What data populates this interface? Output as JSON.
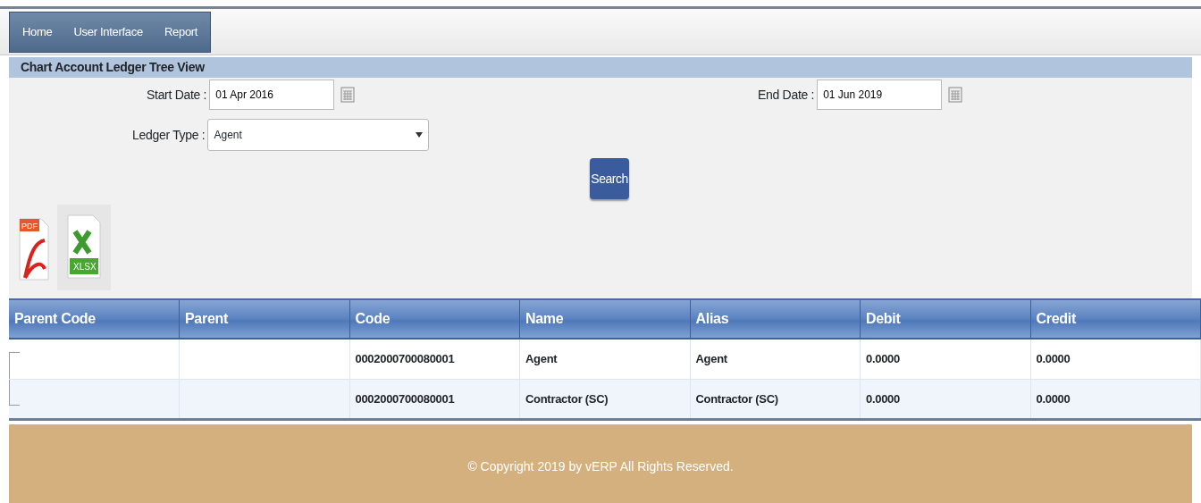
{
  "menu": [
    {
      "label": "Home"
    },
    {
      "label": "User Interface"
    },
    {
      "label": "Report"
    }
  ],
  "page_title": "Chart Account Ledger Tree View",
  "filters": {
    "start_date": {
      "label": "Start Date :",
      "value": "01 Apr 2016"
    },
    "end_date": {
      "label": "End Date :",
      "value": "01 Jun 2019"
    },
    "ledger_type": {
      "label": "Ledger Type :",
      "value": "Agent"
    }
  },
  "search_button": "Search",
  "export": {
    "pdf_label": "PDF",
    "xlsx_label": "XLSX"
  },
  "table": {
    "columns": [
      "Parent Code",
      "Parent",
      "Code",
      "Name",
      "Alias",
      "Debit",
      "Credit"
    ],
    "rows": [
      {
        "cells": [
          "",
          "",
          "0002000700080001",
          "Agent",
          "Agent",
          "0.0000",
          "0.0000"
        ]
      },
      {
        "cells": [
          "",
          "",
          "0002000700080001",
          "Contractor (SC)",
          "Contractor (SC)",
          "0.0000",
          "0.0000"
        ]
      }
    ]
  },
  "footer": "© Copyright 2019 by vERP All Rights Reserved."
}
